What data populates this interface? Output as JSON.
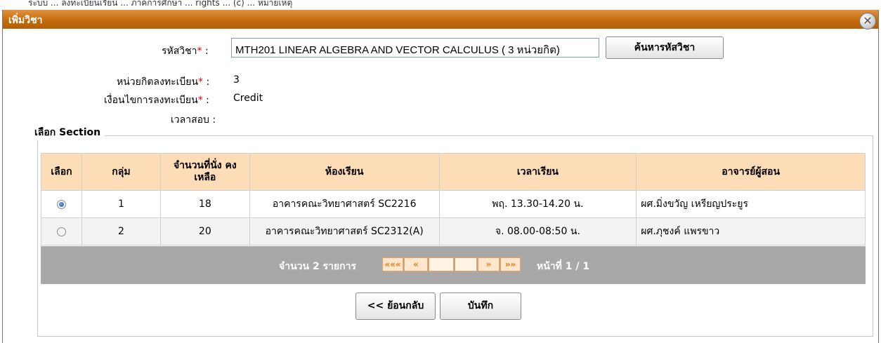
{
  "top_strip_text": "ระบบ ... ลงทะเบียนเรียน ... ภาคการศึกษา ... rights ... (c) ... หมายเหตุ",
  "dialog": {
    "title": "เพิ่มวิชา",
    "close_icon": "close-icon"
  },
  "form": {
    "course_code_label": "รหัสวิชา",
    "course_value": "MTH201 LINEAR ALGEBRA AND VECTOR CALCULUS ( 3 หน่วยกิต)",
    "search_button": "ค้นหารหัสวิชา",
    "credits_label": "หน่วยกิตลงทะเบียน",
    "credits_value": "3",
    "condition_label": "เงื่อนไขการลงทะเบียน",
    "condition_value": "Credit",
    "exam_label": "เวลาสอบ",
    "exam_value": "",
    "required_mark": "*",
    "colon": ":"
  },
  "section": {
    "legend": "เลือก Section",
    "columns": [
      "เลือก",
      "กลุ่ม",
      "จำนวนที่นั่ง คงเหลือ",
      "ห้องเรียน",
      "เวลาเรียน",
      "อาจารย์ผู้สอน"
    ],
    "rows": [
      {
        "selected": true,
        "group": "1",
        "seats": "18",
        "room": "อาคารคณะวิทยาศาสตร์ SC2216",
        "time": "พฤ. 13.30-14.20 น.",
        "teacher": "ผศ.มิ่งขวัญ เหรียญประยูร"
      },
      {
        "selected": false,
        "group": "2",
        "seats": "20",
        "room": "อาคารคณะวิทยาศาสตร์ SC2312(A)",
        "time": "จ. 08.00-08:50 น.",
        "teacher": "ผศ.ภุชงค์ แพรขาว"
      }
    ],
    "pager": {
      "count_text": "จำนวน 2 รายการ",
      "first": "«««",
      "prev": "«",
      "next": "»",
      "last": "»»",
      "page_text": "หน้าที่ 1 / 1"
    }
  },
  "actions": {
    "back": "<< ย้อนกลับ",
    "save": "บันทึก"
  },
  "colors": {
    "titlebar": "#c46b0c",
    "table_header": "#fddcb8",
    "pager_bg": "#a8a8a8",
    "required": "#ee0000"
  }
}
